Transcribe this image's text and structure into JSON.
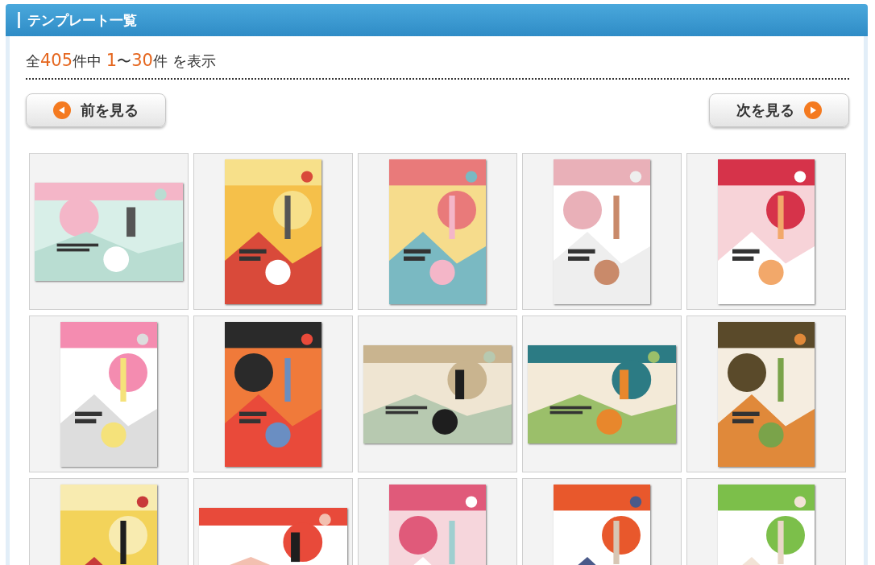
{
  "header": {
    "title": "テンプレート一覧"
  },
  "summary": [
    {
      "text": "全",
      "highlight": false
    },
    {
      "text": "405",
      "highlight": true
    },
    {
      "text": "件中 ",
      "highlight": false
    },
    {
      "text": "1",
      "highlight": true
    },
    {
      "text": "〜",
      "highlight": false
    },
    {
      "text": "30",
      "highlight": true
    },
    {
      "text": "件 を表示",
      "highlight": false
    }
  ],
  "pager": {
    "previous": "前を見る",
    "next": "次を見る"
  }
}
